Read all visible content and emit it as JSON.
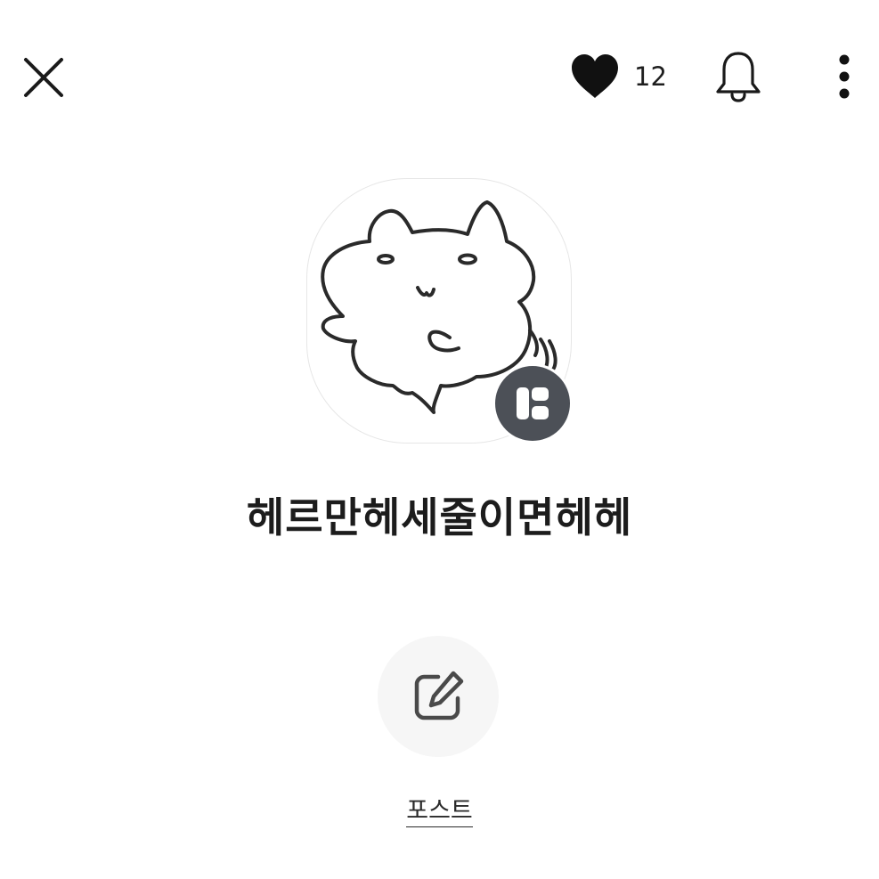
{
  "header": {
    "close_icon": "close-icon",
    "like_icon": "heart-icon",
    "like_count": "12",
    "notification_icon": "bell-icon",
    "more_icon": "more-vertical-icon"
  },
  "profile": {
    "avatar_icon": "cat-doodle-avatar",
    "badge_icon": "blog-badge-icon",
    "badge_color": "#4c5057",
    "title": "헤르만헤세줄이면헤헤"
  },
  "actions": {
    "post_icon": "edit-icon",
    "post_label": "포스트"
  }
}
